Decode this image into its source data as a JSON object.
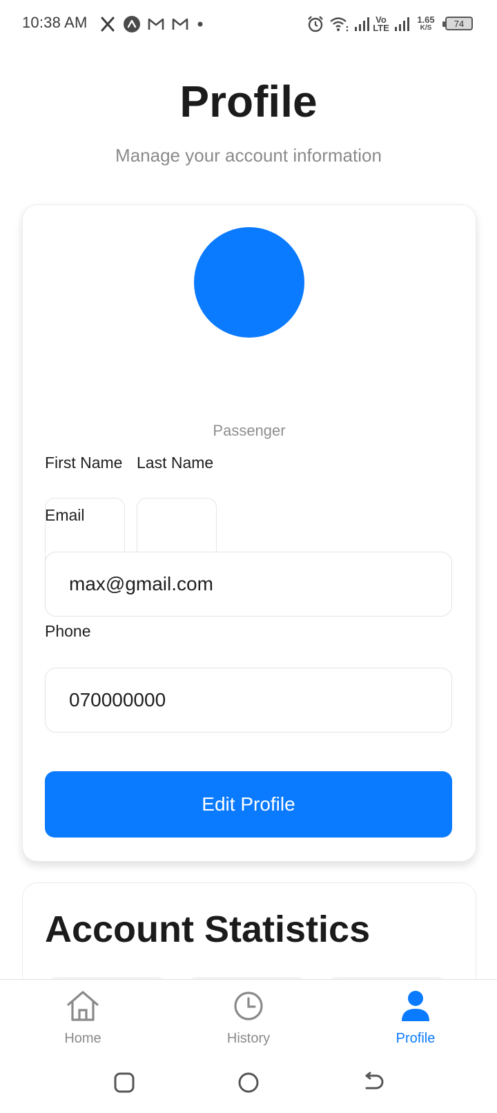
{
  "status_bar": {
    "time": "10:38 AM",
    "notification_icons": [
      "x-icon",
      "app-a-icon",
      "gmail-icon",
      "gmail-icon",
      "dot-icon"
    ],
    "volte_label": "Vo LTE",
    "net_speed": "1.65",
    "net_speed_unit": "K/S",
    "battery": "74"
  },
  "header": {
    "title": "Profile",
    "subtitle": "Manage your account information"
  },
  "profile_card": {
    "avatar_color": "#0a7aff",
    "role": "Passenger",
    "first_name_label": "First Name",
    "first_name_value": "",
    "last_name_label": "Last Name",
    "last_name_value": "",
    "email_label": "Email",
    "email_value": "max@gmail.com",
    "phone_label": "Phone",
    "phone_value": "070000000",
    "edit_button": "Edit Profile"
  },
  "stats_card": {
    "title": "Account Statistics"
  },
  "bottom_nav": {
    "items": [
      {
        "label": "Home",
        "icon": "home-icon",
        "active": false
      },
      {
        "label": "History",
        "icon": "clock-icon",
        "active": false
      },
      {
        "label": "Profile",
        "icon": "person-icon",
        "active": true
      }
    ]
  },
  "colors": {
    "accent": "#0a7aff",
    "muted_text": "#8a8a8a"
  }
}
